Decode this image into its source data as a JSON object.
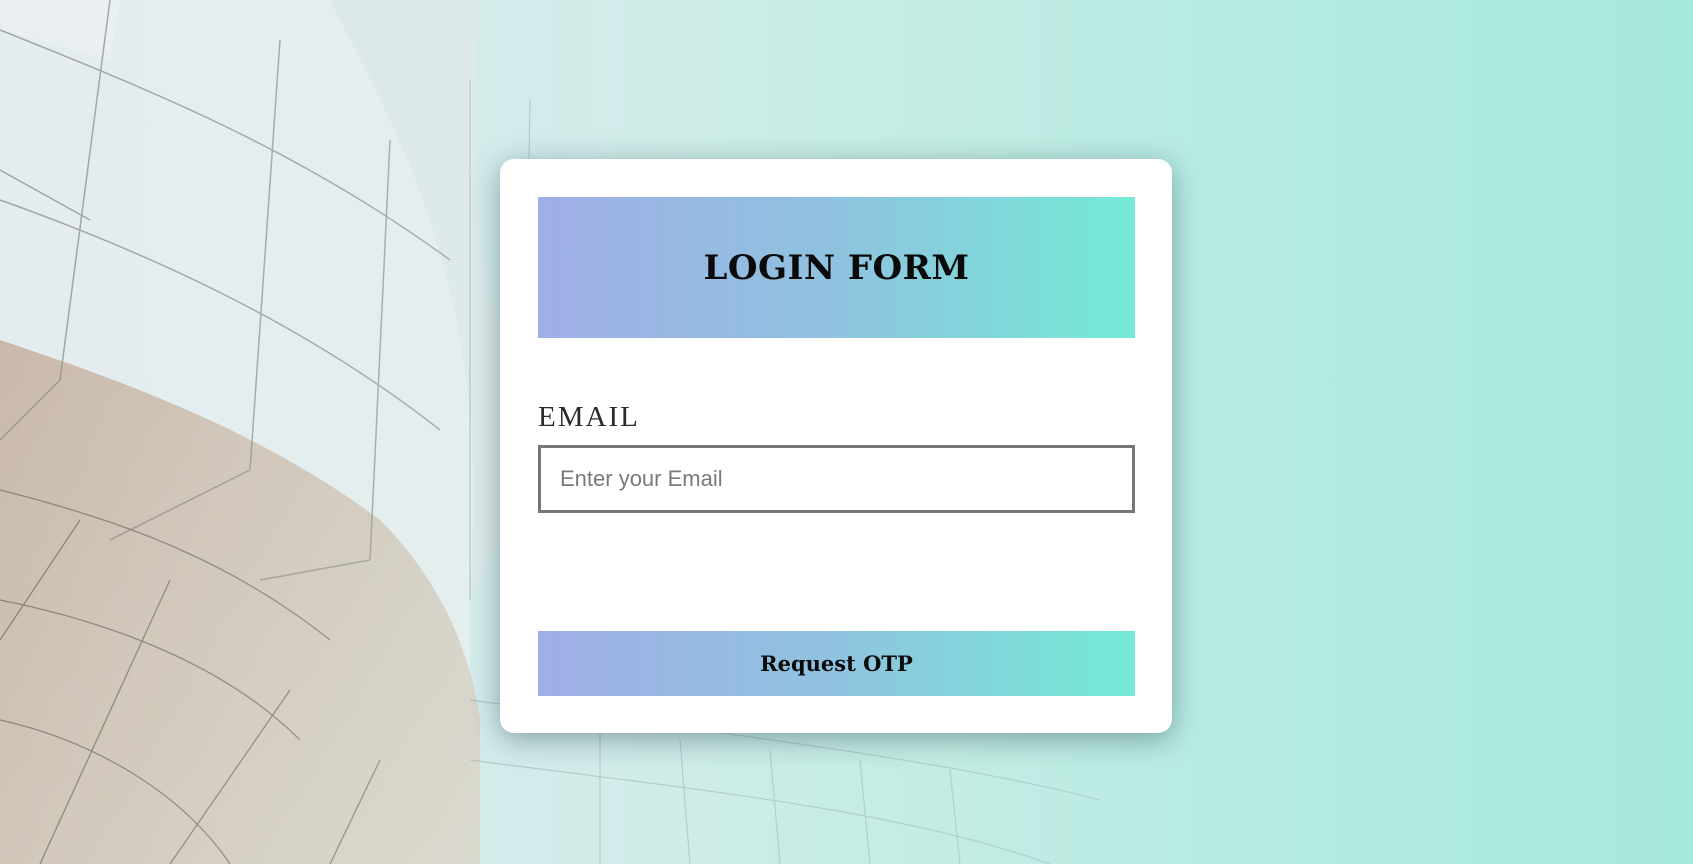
{
  "form": {
    "title": "LOGIN FORM",
    "email_label": "EMAIL",
    "email_placeholder": "Enter your Email",
    "email_value": "",
    "submit_label": "Request OTP"
  },
  "colors": {
    "gradient_start": "#a0aee6",
    "gradient_end": "#74ead6",
    "background_right": "#a6e8dc"
  }
}
